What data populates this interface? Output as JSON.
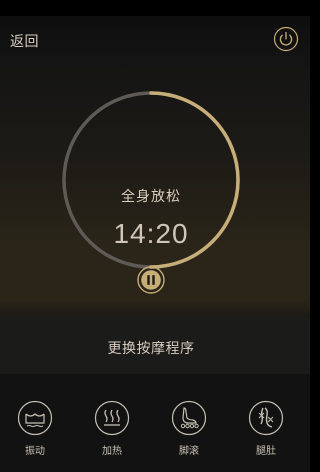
{
  "header": {
    "back_label": "返回",
    "power_icon": "power-icon"
  },
  "timer": {
    "program_name": "全身放松",
    "time_left": "14:20",
    "progress_fraction": 0.5,
    "pause_icon": "pause-icon"
  },
  "program": {
    "change_label": "更换按摩程序"
  },
  "modes": [
    {
      "label": "振动",
      "icon": "vibration-icon"
    },
    {
      "label": "加热",
      "icon": "heat-icon"
    },
    {
      "label": "脚滚",
      "icon": "foot-roller-icon"
    },
    {
      "label": "腿肚",
      "icon": "calf-icon"
    }
  ],
  "colors": {
    "accent": "#c7ae78",
    "track": "#5e5b56",
    "text": "#d8cfc0"
  }
}
